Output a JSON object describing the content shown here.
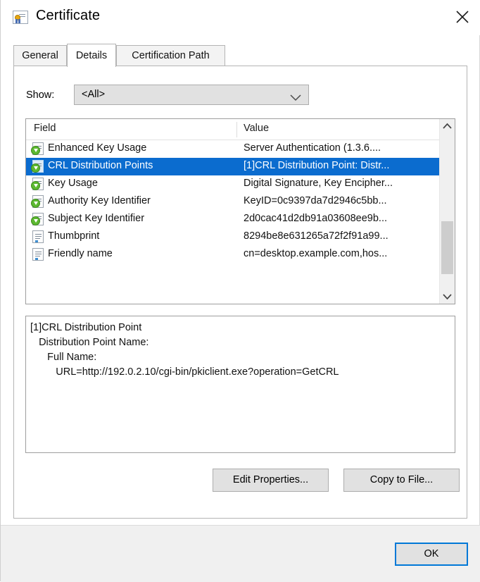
{
  "window": {
    "title": "Certificate",
    "icon": "certificate-icon",
    "close_label": "✕"
  },
  "tabs": [
    {
      "label": "General",
      "active": false
    },
    {
      "label": "Details",
      "active": true
    },
    {
      "label": "Certification Path",
      "active": false
    }
  ],
  "show": {
    "label": "Show:",
    "value": "<All>",
    "arrow": "chevron-down-icon"
  },
  "list": {
    "columns": [
      "Field",
      "Value"
    ],
    "rows": [
      {
        "icon": "extension-icon",
        "field": "Enhanced Key Usage",
        "value": "Server Authentication (1.3.6....",
        "selected": false
      },
      {
        "icon": "extension-icon",
        "field": "CRL Distribution Points",
        "value": "[1]CRL Distribution Point: Distr...",
        "selected": true
      },
      {
        "icon": "extension-icon",
        "field": "Key Usage",
        "value": "Digital Signature, Key Encipher...",
        "selected": false
      },
      {
        "icon": "extension-icon",
        "field": "Authority Key Identifier",
        "value": "KeyID=0c9397da7d2946c5bb...",
        "selected": false
      },
      {
        "icon": "extension-icon",
        "field": "Subject Key Identifier",
        "value": "2d0cac41d2db91a03608ee9b...",
        "selected": false
      },
      {
        "icon": "property-icon",
        "field": "Thumbprint",
        "value": "8294be8e631265a72f2f91a99...",
        "selected": false
      },
      {
        "icon": "property-icon",
        "field": "Friendly name",
        "value": "cn=desktop.example.com,hos...",
        "selected": false
      }
    ],
    "scrollbar": {
      "up_arrow": "chevron-up-icon",
      "down_arrow": "chevron-down-icon"
    }
  },
  "detail": {
    "text": "[1]CRL Distribution Point\n   Distribution Point Name:\n      Full Name:\n         URL=http://192.0.2.10/cgi-bin/pkiclient.exe?operation=GetCRL"
  },
  "buttons": {
    "edit_properties": "Edit Properties...",
    "copy_to_file": "Copy to File...",
    "ok": "OK"
  },
  "colors": {
    "selection": "#0b6ccf",
    "focus_border": "#0078d7",
    "button_face": "#e1e1e1",
    "footer": "#f0f0f0"
  }
}
